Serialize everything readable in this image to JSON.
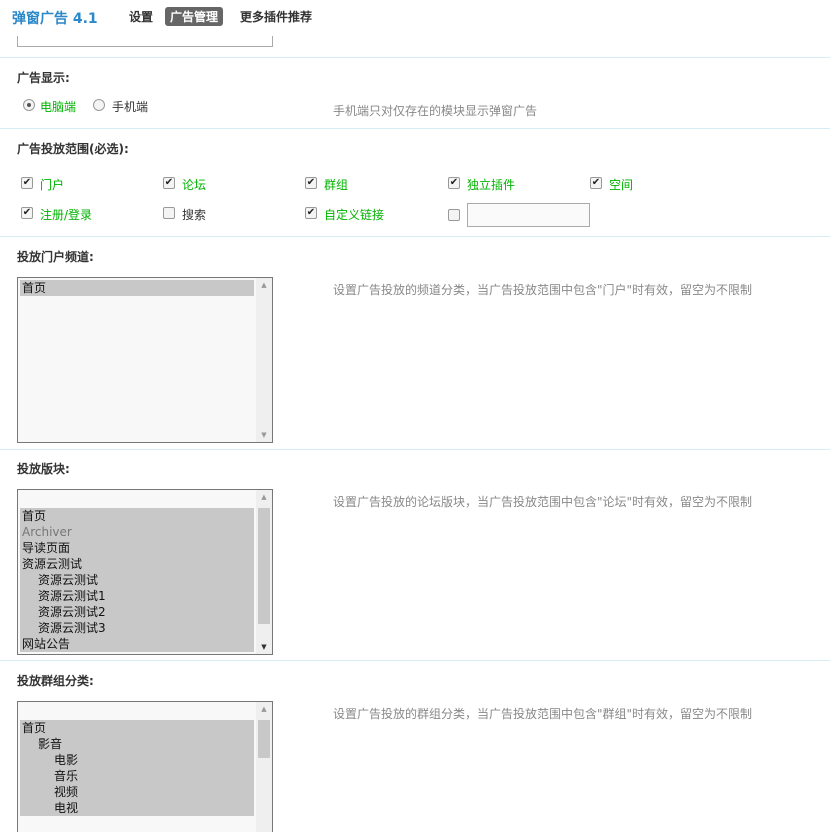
{
  "header": {
    "title": "弹窗广告 4.1",
    "nav": [
      "设置",
      "广告管理",
      "更多插件推荐"
    ]
  },
  "display": {
    "title": "广告显示:",
    "options": [
      "电脑端",
      "手机端"
    ],
    "selected": "电脑端",
    "hint": "手机端只对仅存在的模块显示弹窗广告"
  },
  "scope": {
    "title": "广告投放范围(必选):",
    "row1": [
      {
        "label": "门户",
        "checked": true
      },
      {
        "label": "论坛",
        "checked": true
      },
      {
        "label": "群组",
        "checked": true
      },
      {
        "label": "独立插件",
        "checked": true
      },
      {
        "label": "空间",
        "checked": true
      }
    ],
    "row2": [
      {
        "label": "注册/登录",
        "checked": true
      },
      {
        "label": "搜索",
        "checked": false
      },
      {
        "label": "自定义链接",
        "checked": true
      }
    ],
    "custom_input_value": ""
  },
  "portal": {
    "title": "投放门户频道:",
    "items": [
      "首页"
    ],
    "hint": "设置广告投放的频道分类，当广告投放范围中包含\"门户\"时有效，留空为不限制"
  },
  "forum": {
    "title": "投放版块:",
    "items": [
      "首页",
      "Archiver",
      "导读页面",
      "资源云测试",
      "资源云测试",
      "资源云测试1",
      "资源云测试2",
      "资源云测试3",
      "网站公告"
    ],
    "hint": "设置广告投放的论坛版块，当广告投放范围中包含\"论坛\"时有效，留空为不限制"
  },
  "group": {
    "title": "投放群组分类:",
    "items": [
      "首页",
      "影音",
      "电影",
      "音乐",
      "视频",
      "电视"
    ],
    "hint": "设置广告投放的群组分类，当广告投放范围中包含\"群组\"时有效，留空为不限制"
  }
}
